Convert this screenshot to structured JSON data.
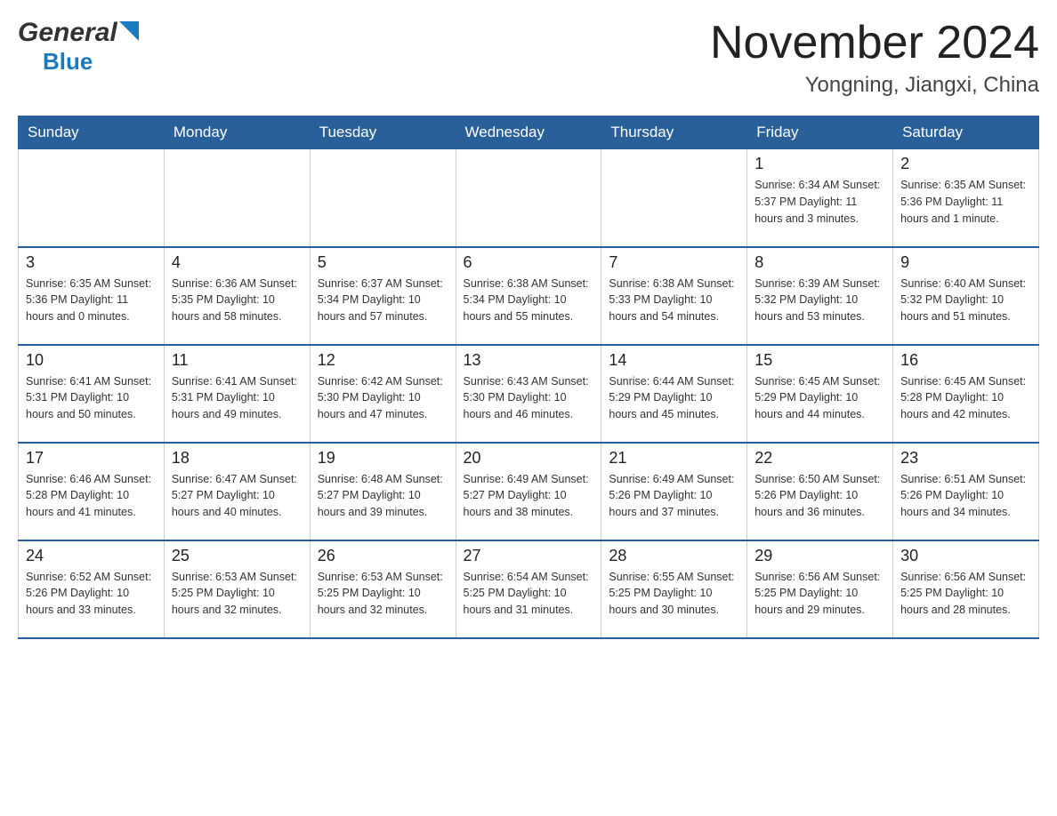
{
  "header": {
    "logo_general": "General",
    "logo_blue": "Blue",
    "month_title": "November 2024",
    "location": "Yongning, Jiangxi, China"
  },
  "days_of_week": [
    "Sunday",
    "Monday",
    "Tuesday",
    "Wednesday",
    "Thursday",
    "Friday",
    "Saturday"
  ],
  "weeks": [
    [
      {
        "day": "",
        "info": ""
      },
      {
        "day": "",
        "info": ""
      },
      {
        "day": "",
        "info": ""
      },
      {
        "day": "",
        "info": ""
      },
      {
        "day": "",
        "info": ""
      },
      {
        "day": "1",
        "info": "Sunrise: 6:34 AM\nSunset: 5:37 PM\nDaylight: 11 hours\nand 3 minutes."
      },
      {
        "day": "2",
        "info": "Sunrise: 6:35 AM\nSunset: 5:36 PM\nDaylight: 11 hours\nand 1 minute."
      }
    ],
    [
      {
        "day": "3",
        "info": "Sunrise: 6:35 AM\nSunset: 5:36 PM\nDaylight: 11 hours\nand 0 minutes."
      },
      {
        "day": "4",
        "info": "Sunrise: 6:36 AM\nSunset: 5:35 PM\nDaylight: 10 hours\nand 58 minutes."
      },
      {
        "day": "5",
        "info": "Sunrise: 6:37 AM\nSunset: 5:34 PM\nDaylight: 10 hours\nand 57 minutes."
      },
      {
        "day": "6",
        "info": "Sunrise: 6:38 AM\nSunset: 5:34 PM\nDaylight: 10 hours\nand 55 minutes."
      },
      {
        "day": "7",
        "info": "Sunrise: 6:38 AM\nSunset: 5:33 PM\nDaylight: 10 hours\nand 54 minutes."
      },
      {
        "day": "8",
        "info": "Sunrise: 6:39 AM\nSunset: 5:32 PM\nDaylight: 10 hours\nand 53 minutes."
      },
      {
        "day": "9",
        "info": "Sunrise: 6:40 AM\nSunset: 5:32 PM\nDaylight: 10 hours\nand 51 minutes."
      }
    ],
    [
      {
        "day": "10",
        "info": "Sunrise: 6:41 AM\nSunset: 5:31 PM\nDaylight: 10 hours\nand 50 minutes."
      },
      {
        "day": "11",
        "info": "Sunrise: 6:41 AM\nSunset: 5:31 PM\nDaylight: 10 hours\nand 49 minutes."
      },
      {
        "day": "12",
        "info": "Sunrise: 6:42 AM\nSunset: 5:30 PM\nDaylight: 10 hours\nand 47 minutes."
      },
      {
        "day": "13",
        "info": "Sunrise: 6:43 AM\nSunset: 5:30 PM\nDaylight: 10 hours\nand 46 minutes."
      },
      {
        "day": "14",
        "info": "Sunrise: 6:44 AM\nSunset: 5:29 PM\nDaylight: 10 hours\nand 45 minutes."
      },
      {
        "day": "15",
        "info": "Sunrise: 6:45 AM\nSunset: 5:29 PM\nDaylight: 10 hours\nand 44 minutes."
      },
      {
        "day": "16",
        "info": "Sunrise: 6:45 AM\nSunset: 5:28 PM\nDaylight: 10 hours\nand 42 minutes."
      }
    ],
    [
      {
        "day": "17",
        "info": "Sunrise: 6:46 AM\nSunset: 5:28 PM\nDaylight: 10 hours\nand 41 minutes."
      },
      {
        "day": "18",
        "info": "Sunrise: 6:47 AM\nSunset: 5:27 PM\nDaylight: 10 hours\nand 40 minutes."
      },
      {
        "day": "19",
        "info": "Sunrise: 6:48 AM\nSunset: 5:27 PM\nDaylight: 10 hours\nand 39 minutes."
      },
      {
        "day": "20",
        "info": "Sunrise: 6:49 AM\nSunset: 5:27 PM\nDaylight: 10 hours\nand 38 minutes."
      },
      {
        "day": "21",
        "info": "Sunrise: 6:49 AM\nSunset: 5:26 PM\nDaylight: 10 hours\nand 37 minutes."
      },
      {
        "day": "22",
        "info": "Sunrise: 6:50 AM\nSunset: 5:26 PM\nDaylight: 10 hours\nand 36 minutes."
      },
      {
        "day": "23",
        "info": "Sunrise: 6:51 AM\nSunset: 5:26 PM\nDaylight: 10 hours\nand 34 minutes."
      }
    ],
    [
      {
        "day": "24",
        "info": "Sunrise: 6:52 AM\nSunset: 5:26 PM\nDaylight: 10 hours\nand 33 minutes."
      },
      {
        "day": "25",
        "info": "Sunrise: 6:53 AM\nSunset: 5:25 PM\nDaylight: 10 hours\nand 32 minutes."
      },
      {
        "day": "26",
        "info": "Sunrise: 6:53 AM\nSunset: 5:25 PM\nDaylight: 10 hours\nand 32 minutes."
      },
      {
        "day": "27",
        "info": "Sunrise: 6:54 AM\nSunset: 5:25 PM\nDaylight: 10 hours\nand 31 minutes."
      },
      {
        "day": "28",
        "info": "Sunrise: 6:55 AM\nSunset: 5:25 PM\nDaylight: 10 hours\nand 30 minutes."
      },
      {
        "day": "29",
        "info": "Sunrise: 6:56 AM\nSunset: 5:25 PM\nDaylight: 10 hours\nand 29 minutes."
      },
      {
        "day": "30",
        "info": "Sunrise: 6:56 AM\nSunset: 5:25 PM\nDaylight: 10 hours\nand 28 minutes."
      }
    ]
  ]
}
